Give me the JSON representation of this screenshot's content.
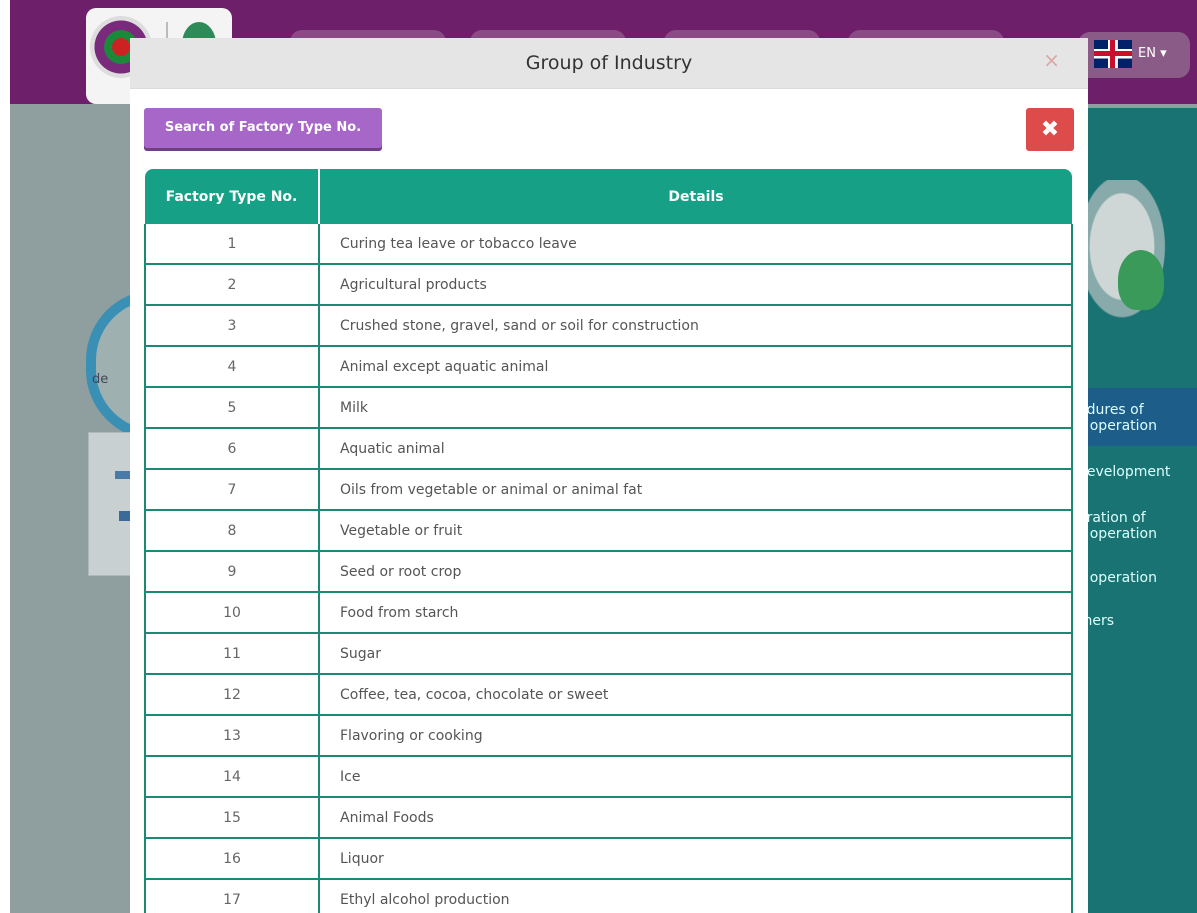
{
  "header": {
    "language": "EN"
  },
  "background_side_menu": [
    "edures of\ns operation",
    "development",
    "aration of\ns operation",
    "s operation",
    "thers"
  ],
  "background_circle_text": "de",
  "modal": {
    "title": "Group of Industry",
    "close_symbol": "×",
    "search_button_label": "Search of Factory Type No.",
    "close_button_symbol": "✖"
  },
  "table": {
    "headers": [
      "Factory Type No.",
      "Details"
    ],
    "rows": [
      {
        "no": "1",
        "detail": "Curing tea leave or tobacco leave"
      },
      {
        "no": "2",
        "detail": "Agricultural products"
      },
      {
        "no": "3",
        "detail": "Crushed stone, gravel, sand or soil for construction"
      },
      {
        "no": "4",
        "detail": "Animal except aquatic animal"
      },
      {
        "no": "5",
        "detail": "Milk"
      },
      {
        "no": "6",
        "detail": "Aquatic animal"
      },
      {
        "no": "7",
        "detail": "Oils from vegetable or animal or animal fat"
      },
      {
        "no": "8",
        "detail": "Vegetable or fruit"
      },
      {
        "no": "9",
        "detail": "Seed or root crop"
      },
      {
        "no": "10",
        "detail": "Food from starch"
      },
      {
        "no": "11",
        "detail": "Sugar"
      },
      {
        "no": "12",
        "detail": "Coffee, tea, cocoa, chocolate or sweet"
      },
      {
        "no": "13",
        "detail": "Flavoring or cooking"
      },
      {
        "no": "14",
        "detail": "Ice"
      },
      {
        "no": "15",
        "detail": "Animal Foods"
      },
      {
        "no": "16",
        "detail": "Liquor"
      },
      {
        "no": "17",
        "detail": "Ethyl alcohol production"
      }
    ]
  },
  "colors": {
    "header_purple": "#6d1f69",
    "table_header_teal": "#16a085",
    "search_button": "#a767c9",
    "close_button_red": "#dd4b4b"
  }
}
